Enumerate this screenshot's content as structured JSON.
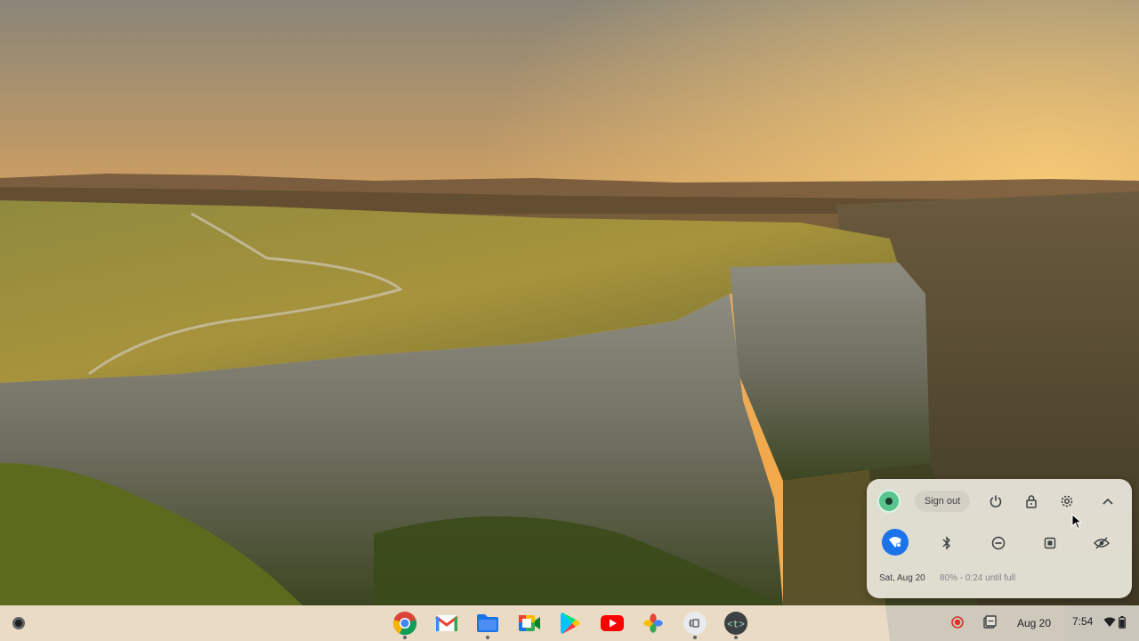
{
  "quick_settings": {
    "sign_out_label": "Sign out",
    "date": "Sat, Aug 20",
    "battery_status": "80% - 0:24 until full",
    "icons": [
      "avatar",
      "power-icon",
      "lock-icon",
      "settings-icon",
      "collapse-icon",
      "wifi-icon",
      "bluetooth-icon",
      "do-not-disturb-icon",
      "screen-capture-icon",
      "privacy-icon"
    ],
    "accent": "#1a73e8"
  },
  "shelf": {
    "apps": [
      {
        "name": "Chrome",
        "icon": "chrome-icon"
      },
      {
        "name": "Gmail",
        "icon": "gmail-icon"
      },
      {
        "name": "Files",
        "icon": "files-icon"
      },
      {
        "name": "Meet",
        "icon": "meet-icon"
      },
      {
        "name": "Play Store",
        "icon": "play-store-icon"
      },
      {
        "name": "YouTube",
        "icon": "youtube-icon"
      },
      {
        "name": "Photos",
        "icon": "photos-icon"
      },
      {
        "name": "Screen Recorder",
        "icon": "screencast-icon"
      },
      {
        "name": "Terminal",
        "icon": "terminal-icon"
      }
    ],
    "tray_date": "Aug 20",
    "time": "7:54"
  }
}
